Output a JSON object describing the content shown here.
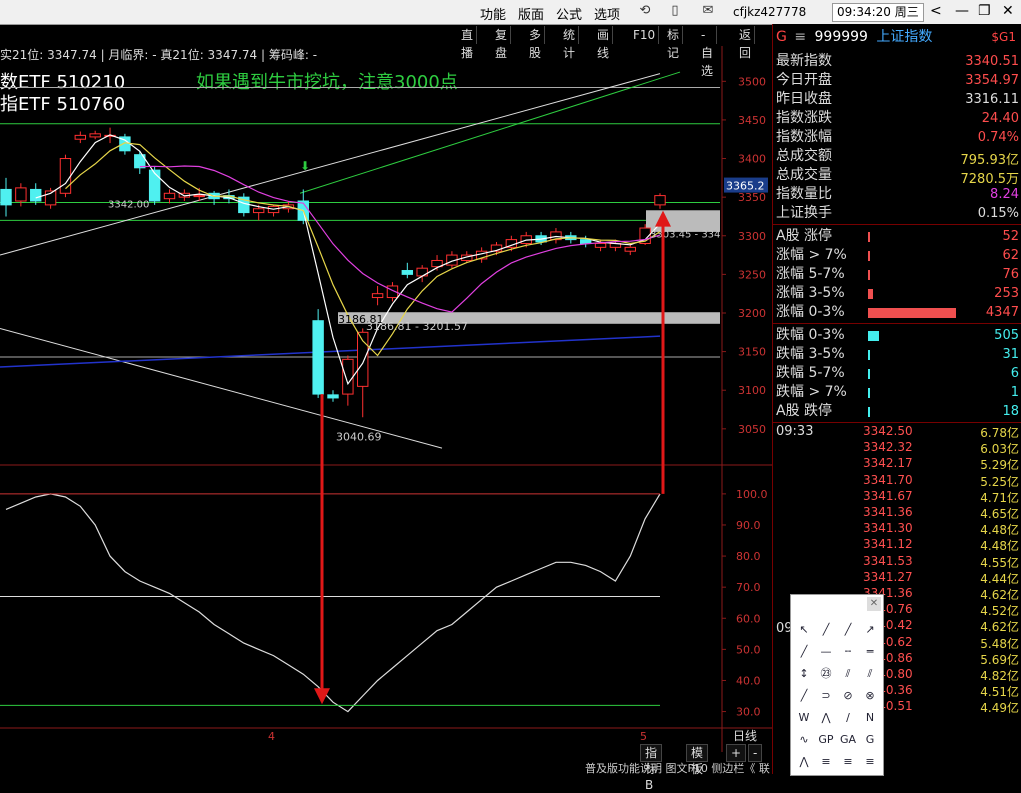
{
  "menu": {
    "items": [
      "功能",
      "版面",
      "公式",
      "选项"
    ],
    "user": "cfjkz427778",
    "clock": "09:34:20 周三"
  },
  "toolbar": [
    "直播",
    "复盘",
    "多股",
    "统计",
    "画线",
    "F10",
    "标记",
    "-自选",
    "返回"
  ],
  "chart_header": {
    "info": "实21位: 3347.74 | 月临界: - 真21位: 3347.74 | 筹码峰: -",
    "etf1": "数ETF 510210",
    "etf2": "指ETF 510760",
    "note": "如果遇到牛市挖坑，注意3000点"
  },
  "chart_data": {
    "type": "candlestick",
    "price_axis": {
      "ticks": [
        3500,
        3450,
        3400,
        3350,
        3300,
        3250,
        3200,
        3150,
        3100,
        3050
      ],
      "range": [
        3020,
        3525
      ]
    },
    "indicator_axis": {
      "ticks": [
        100.0,
        90.0,
        80.0,
        70.0,
        60.0,
        50.0,
        40.0,
        30.0
      ],
      "range": [
        26,
        108
      ]
    },
    "x_labels": [
      "4",
      "5"
    ],
    "candles": [
      {
        "o": 3360,
        "c": 3340,
        "h": 3375,
        "l": 3325
      },
      {
        "o": 3345,
        "c": 3362,
        "h": 3368,
        "l": 3338
      },
      {
        "o": 3360,
        "c": 3345,
        "h": 3368,
        "l": 3340
      },
      {
        "o": 3340,
        "c": 3358,
        "h": 3362,
        "l": 3335
      },
      {
        "o": 3355,
        "c": 3400,
        "h": 3405,
        "l": 3350
      },
      {
        "o": 3425,
        "c": 3430,
        "h": 3435,
        "l": 3420
      },
      {
        "o": 3428,
        "c": 3432,
        "h": 3436,
        "l": 3425
      },
      {
        "o": 3430,
        "c": 3430,
        "h": 3440,
        "l": 3420
      },
      {
        "o": 3428,
        "c": 3410,
        "h": 3432,
        "l": 3405
      },
      {
        "o": 3405,
        "c": 3388,
        "h": 3410,
        "l": 3380
      },
      {
        "o": 3385,
        "c": 3345,
        "h": 3390,
        "l": 3340
      },
      {
        "o": 3348,
        "c": 3355,
        "h": 3360,
        "l": 3342
      },
      {
        "o": 3350,
        "c": 3355,
        "h": 3360,
        "l": 3345
      },
      {
        "o": 3352,
        "c": 3352,
        "h": 3362,
        "l": 3345
      },
      {
        "o": 3355,
        "c": 3348,
        "h": 3358,
        "l": 3340
      },
      {
        "o": 3352,
        "c": 3348,
        "h": 3360,
        "l": 3342
      },
      {
        "o": 3350,
        "c": 3330,
        "h": 3355,
        "l": 3325
      },
      {
        "o": 3330,
        "c": 3335,
        "h": 3340,
        "l": 3320
      },
      {
        "o": 3330,
        "c": 3338,
        "h": 3340,
        "l": 3325
      },
      {
        "o": 3335,
        "c": 3340,
        "h": 3345,
        "l": 3330
      },
      {
        "o": 3345,
        "c": 3320,
        "h": 3360,
        "l": 3315
      },
      {
        "o": 3190,
        "c": 3095,
        "h": 3205,
        "l": 3090
      },
      {
        "o": 3094,
        "c": 3090,
        "h": 3100,
        "l": 3085
      },
      {
        "o": 3095,
        "c": 3140,
        "h": 3145,
        "l": 3080
      },
      {
        "o": 3105,
        "c": 3175,
        "h": 3180,
        "l": 3065
      },
      {
        "o": 3220,
        "c": 3225,
        "h": 3235,
        "l": 3210
      },
      {
        "o": 3220,
        "c": 3235,
        "h": 3240,
        "l": 3215
      },
      {
        "o": 3255,
        "c": 3250,
        "h": 3265,
        "l": 3245
      },
      {
        "o": 3248,
        "c": 3258,
        "h": 3262,
        "l": 3240
      },
      {
        "o": 3260,
        "c": 3268,
        "h": 3275,
        "l": 3255
      },
      {
        "o": 3262,
        "c": 3275,
        "h": 3280,
        "l": 3258
      },
      {
        "o": 3268,
        "c": 3275,
        "h": 3280,
        "l": 3265
      },
      {
        "o": 3270,
        "c": 3280,
        "h": 3285,
        "l": 3265
      },
      {
        "o": 3280,
        "c": 3288,
        "h": 3292,
        "l": 3275
      },
      {
        "o": 3285,
        "c": 3295,
        "h": 3300,
        "l": 3280
      },
      {
        "o": 3290,
        "c": 3300,
        "h": 3305,
        "l": 3285
      },
      {
        "o": 3300,
        "c": 3292,
        "h": 3305,
        "l": 3288
      },
      {
        "o": 3295,
        "c": 3305,
        "h": 3310,
        "l": 3290
      },
      {
        "o": 3300,
        "c": 3295,
        "h": 3305,
        "l": 3290
      },
      {
        "o": 3295,
        "c": 3290,
        "h": 3300,
        "l": 3285
      },
      {
        "o": 3285,
        "c": 3290,
        "h": 3295,
        "l": 3280
      },
      {
        "o": 3285,
        "c": 3290,
        "h": 3295,
        "l": 3280
      },
      {
        "o": 3280,
        "c": 3285,
        "h": 3290,
        "l": 3275
      },
      {
        "o": 3290,
        "c": 3310,
        "h": 3315,
        "l": 3288
      },
      {
        "o": 3340,
        "c": 3352,
        "h": 3355,
        "l": 3335
      }
    ],
    "labels": {
      "low_mark": "3040.69",
      "gap_mark": "3186.81",
      "gap_range": "3186.81 - 3201.57",
      "left_mark": "3342.00",
      "right_gap": "3303.45 - 334",
      "last_price": "3365.2"
    },
    "indicator": [
      95,
      97,
      99,
      100,
      99,
      96,
      90,
      80,
      75,
      72,
      70,
      68,
      65,
      62,
      58,
      55,
      52,
      50,
      48,
      45,
      42,
      38,
      33,
      30,
      35,
      40,
      44,
      48,
      52,
      56,
      58,
      62,
      66,
      70,
      72,
      74,
      76,
      78,
      78,
      77,
      75,
      72,
      80,
      92,
      100
    ]
  },
  "quote": {
    "code": "999999",
    "name": "上证指数",
    "tag": "$G1",
    "rows": [
      {
        "label": "最新指数",
        "value": "3340.51",
        "color": "red"
      },
      {
        "label": "今日开盘",
        "value": "3354.97",
        "color": "red"
      },
      {
        "label": "昨日收盘",
        "value": "3316.11",
        "color": "wht"
      },
      {
        "label": "指数涨跌",
        "value": "24.40",
        "color": "red"
      },
      {
        "label": "指数涨幅",
        "value": "0.74%",
        "color": "red"
      },
      {
        "label": "总成交额",
        "value": "795.93亿",
        "color": "yel"
      },
      {
        "label": "总成交量",
        "value": "7280.5万",
        "color": "yel"
      },
      {
        "label": "指数量比",
        "value": "8.24",
        "color": "mag"
      },
      {
        "label": "上证换手",
        "value": "0.15%",
        "color": "wht"
      }
    ],
    "breadth_up": [
      {
        "label": "A股 涨停",
        "value": "52",
        "frac": 0.01
      },
      {
        "label": "涨幅 > 7%",
        "value": "62",
        "frac": 0.01
      },
      {
        "label": "涨幅 5-7%",
        "value": "76",
        "frac": 0.01
      },
      {
        "label": "涨幅 3-5%",
        "value": "253",
        "frac": 0.06
      },
      {
        "label": "涨幅 0-3%",
        "value": "4347",
        "frac": 1.0
      }
    ],
    "breadth_down": [
      {
        "label": "跌幅 0-3%",
        "value": "505",
        "frac": 0.12
      },
      {
        "label": "跌幅 3-5%",
        "value": "31",
        "frac": 0.01
      },
      {
        "label": "跌幅 5-7%",
        "value": "6",
        "frac": 0.01
      },
      {
        "label": "跌幅 > 7%",
        "value": "1",
        "frac": 0.01
      },
      {
        "label": "A股 跌停",
        "value": "18",
        "frac": 0.01
      }
    ],
    "ticks_time1": "09:33",
    "ticks_time2": "09",
    "ticks": [
      {
        "p": "3342.50",
        "v": "6.78亿"
      },
      {
        "p": "3342.32",
        "v": "6.03亿"
      },
      {
        "p": "3342.17",
        "v": "5.29亿"
      },
      {
        "p": "3341.70",
        "v": "5.25亿"
      },
      {
        "p": "3341.67",
        "v": "4.71亿"
      },
      {
        "p": "3341.36",
        "v": "4.65亿"
      },
      {
        "p": "3341.30",
        "v": "4.48亿"
      },
      {
        "p": "3341.12",
        "v": "4.48亿"
      },
      {
        "p": "3341.53",
        "v": "4.55亿"
      },
      {
        "p": "3341.27",
        "v": "4.44亿"
      },
      {
        "p": "3341.36",
        "v": "4.62亿"
      },
      {
        "p": "3340.76",
        "v": "4.52亿"
      },
      {
        "p": "3340.42",
        "v": "4.62亿"
      },
      {
        "p": "3340.62",
        "v": "5.48亿"
      },
      {
        "p": "3340.86",
        "v": "5.69亿"
      },
      {
        "p": "3340.80",
        "v": "4.82亿"
      },
      {
        "p": "3340.36",
        "v": "4.51亿"
      },
      {
        "p": "3340.51",
        "v": "4.49亿"
      }
    ]
  },
  "bottom": {
    "period": "日线",
    "btns": [
      "指标B",
      "模板",
      "+",
      "-"
    ],
    "status": "普及版功能说明 图文F10 侧边栏《 联 值 主 逆 观"
  }
}
